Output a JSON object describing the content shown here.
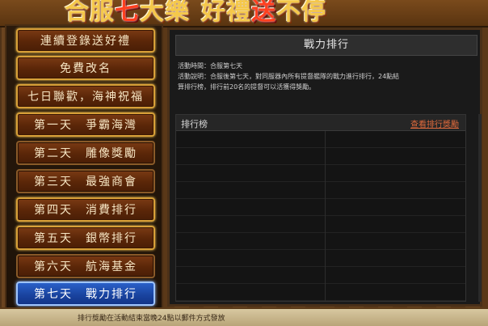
{
  "title": {
    "part1": "合服",
    "highlight1": "七",
    "part2": "大樂",
    "part3": "好禮",
    "highlight2": "送",
    "part4": "不停"
  },
  "menu": [
    {
      "label": "連續登錄送好禮"
    },
    {
      "label": "免費改名"
    },
    {
      "label": "七日聯歡，海神祝福"
    },
    {
      "label": "第一天　爭霸海灣"
    },
    {
      "label": "第二天　雕像獎勵"
    },
    {
      "label": "第三天　最強商會"
    },
    {
      "label": "第四天　消費排行"
    },
    {
      "label": "第五天　銀幣排行"
    },
    {
      "label": "第六天　航海基金"
    },
    {
      "label": "第七天　戰力排行"
    }
  ],
  "panel": {
    "heading": "戰力排行",
    "time_line": "活動時間：合服第七天",
    "desc_line1": "活動說明：合服後第七天，對同服器內所有提督艦隊的戰力進行排行，24點結",
    "desc_line2": "算排行榜，排行前20名的提督可以活獲得獎勵。"
  },
  "ranking": {
    "title": "排行榜",
    "link": "查看排行獎勵"
  },
  "footer": {
    "note": "排行獎勵在活動結束當晚24點以郵件方式發放"
  },
  "colors": {
    "gold": "#d8a038",
    "active_blue": "#2a60c8",
    "link_orange": "#e06a3c"
  }
}
